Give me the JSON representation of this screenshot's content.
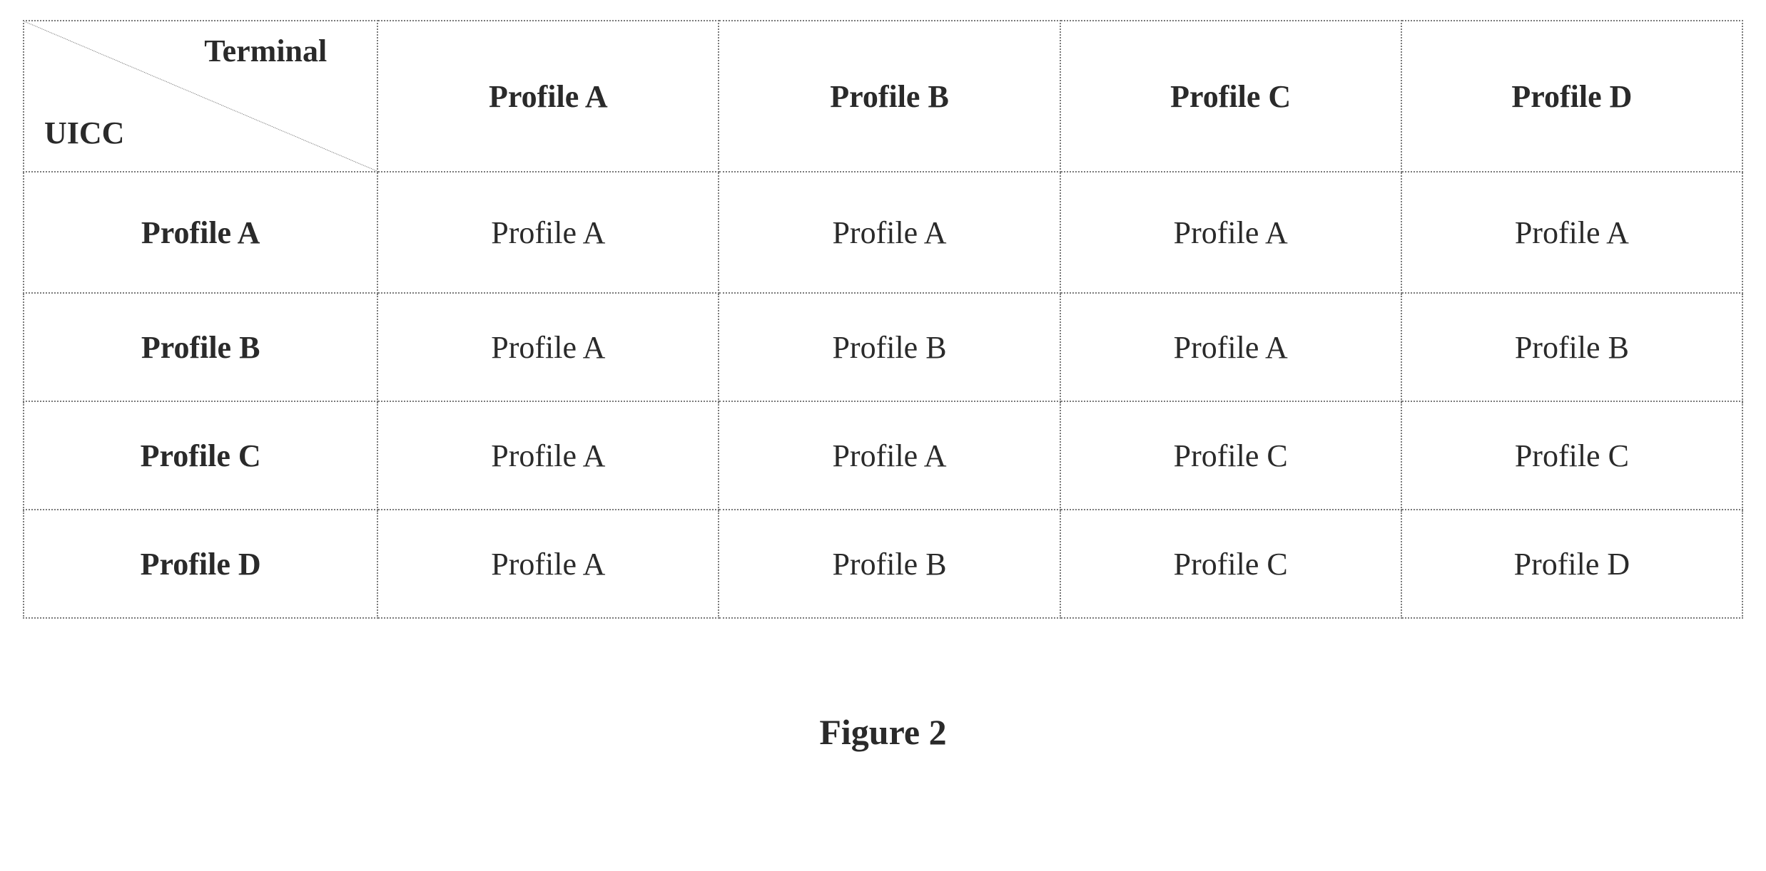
{
  "table": {
    "corner": {
      "top": "Terminal",
      "bottom": "UICC"
    },
    "col_headers": [
      "Profile A",
      "Profile B",
      "Profile C",
      "Profile D"
    ],
    "rows": [
      {
        "header": "Profile A",
        "cells": [
          "Profile A",
          "Profile A",
          "Profile A",
          "Profile A"
        ]
      },
      {
        "header": "Profile B",
        "cells": [
          "Profile A",
          "Profile B",
          "Profile A",
          "Profile B"
        ]
      },
      {
        "header": "Profile C",
        "cells": [
          "Profile A",
          "Profile A",
          "Profile C",
          "Profile C"
        ]
      },
      {
        "header": "Profile D",
        "cells": [
          "Profile A",
          "Profile B",
          "Profile C",
          "Profile D"
        ]
      }
    ]
  },
  "caption": "Figure 2",
  "chart_data": {
    "type": "table",
    "title": "Figure 2",
    "x_axis_label": "Terminal",
    "y_axis_label": "UICC",
    "columns": [
      "Profile A",
      "Profile B",
      "Profile C",
      "Profile D"
    ],
    "rows": [
      "Profile A",
      "Profile B",
      "Profile C",
      "Profile D"
    ],
    "values": [
      [
        "Profile A",
        "Profile A",
        "Profile A",
        "Profile A"
      ],
      [
        "Profile A",
        "Profile B",
        "Profile A",
        "Profile B"
      ],
      [
        "Profile A",
        "Profile A",
        "Profile C",
        "Profile C"
      ],
      [
        "Profile A",
        "Profile B",
        "Profile C",
        "Profile D"
      ]
    ]
  }
}
